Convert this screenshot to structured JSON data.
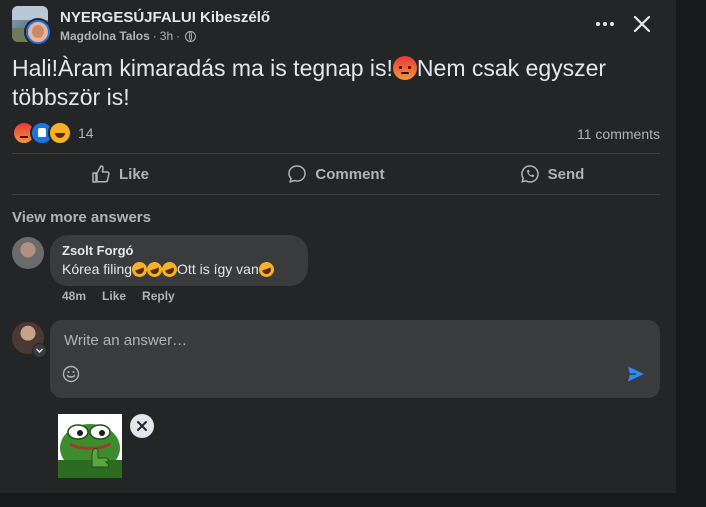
{
  "header": {
    "group_name": "NYERGESÚJFALUI Kibeszélő",
    "author": "Magdolna Talos",
    "separator": "·",
    "time": "3h",
    "separator2": "·"
  },
  "post": {
    "text_part1": "Hali!Àram kimaradás ma is tegnap is!",
    "text_part2": "Nem csak egyszer többször is!"
  },
  "reactions": {
    "count": "14",
    "comments": "11 comments",
    "types": [
      "angry-icon",
      "like-icon",
      "haha-icon"
    ]
  },
  "actions": {
    "like": "Like",
    "comment": "Comment",
    "send": "Send"
  },
  "comments_section": {
    "view_more": "View more answers",
    "comment": {
      "author": "Zsolt Forgó",
      "text_a": "Kórea filing",
      "text_b": "Ott is így van",
      "time": "48m",
      "like": "Like",
      "reply": "Reply"
    }
  },
  "composer": {
    "placeholder": "Write an answer…"
  },
  "colors": {
    "background": "#18191a",
    "card": "#242526",
    "bubble": "#3a3b3c",
    "text": "#e4e6eb",
    "secondary": "#b0b3b8",
    "accent": "#1b74e4",
    "send": "#2d88ff"
  }
}
